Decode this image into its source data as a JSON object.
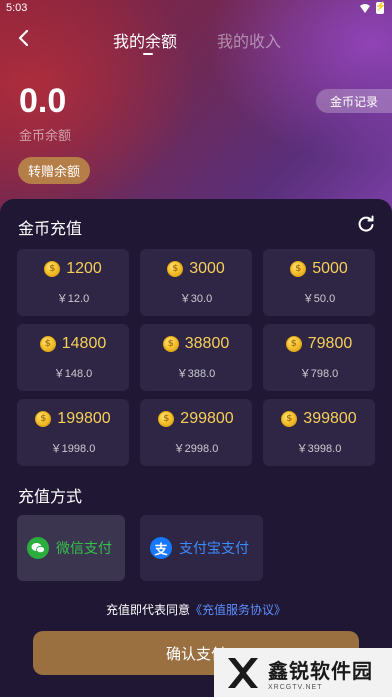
{
  "status_bar": {
    "time": "5:03"
  },
  "nav": {
    "tabs": [
      {
        "label": "我的余额",
        "active": true
      },
      {
        "label": "我的收入",
        "active": false
      }
    ]
  },
  "balance": {
    "value": "0.0",
    "label": "金币余额",
    "record_button": "金币记录",
    "transfer_button": "转赠余额"
  },
  "recharge": {
    "title": "金币充值",
    "packages": [
      {
        "coins": "1200",
        "price": "￥12.0"
      },
      {
        "coins": "3000",
        "price": "￥30.0"
      },
      {
        "coins": "5000",
        "price": "￥50.0"
      },
      {
        "coins": "14800",
        "price": "￥148.0"
      },
      {
        "coins": "38800",
        "price": "￥388.0"
      },
      {
        "coins": "79800",
        "price": "￥798.0"
      },
      {
        "coins": "199800",
        "price": "￥1998.0"
      },
      {
        "coins": "299800",
        "price": "￥2998.0"
      },
      {
        "coins": "399800",
        "price": "￥3998.0"
      }
    ]
  },
  "payment": {
    "title": "充值方式",
    "methods": [
      {
        "label": "微信支付",
        "icon": "wechat-icon",
        "selected": true
      },
      {
        "label": "支付宝支付",
        "icon": "alipay-icon",
        "selected": false
      }
    ]
  },
  "agreement": {
    "text": "充值即代表同意",
    "link": "《充值服务协议》"
  },
  "confirm": {
    "label": "确认支付"
  },
  "watermark": {
    "name": "鑫锐软件园",
    "site": "XRCGTV.NET"
  },
  "colors": {
    "coin_gold": "#f6cf5a",
    "accent_button": "#9a7040",
    "wechat_green": "#35c04a",
    "alipay_blue": "#3d8cff",
    "link_blue": "#5e8fff"
  }
}
